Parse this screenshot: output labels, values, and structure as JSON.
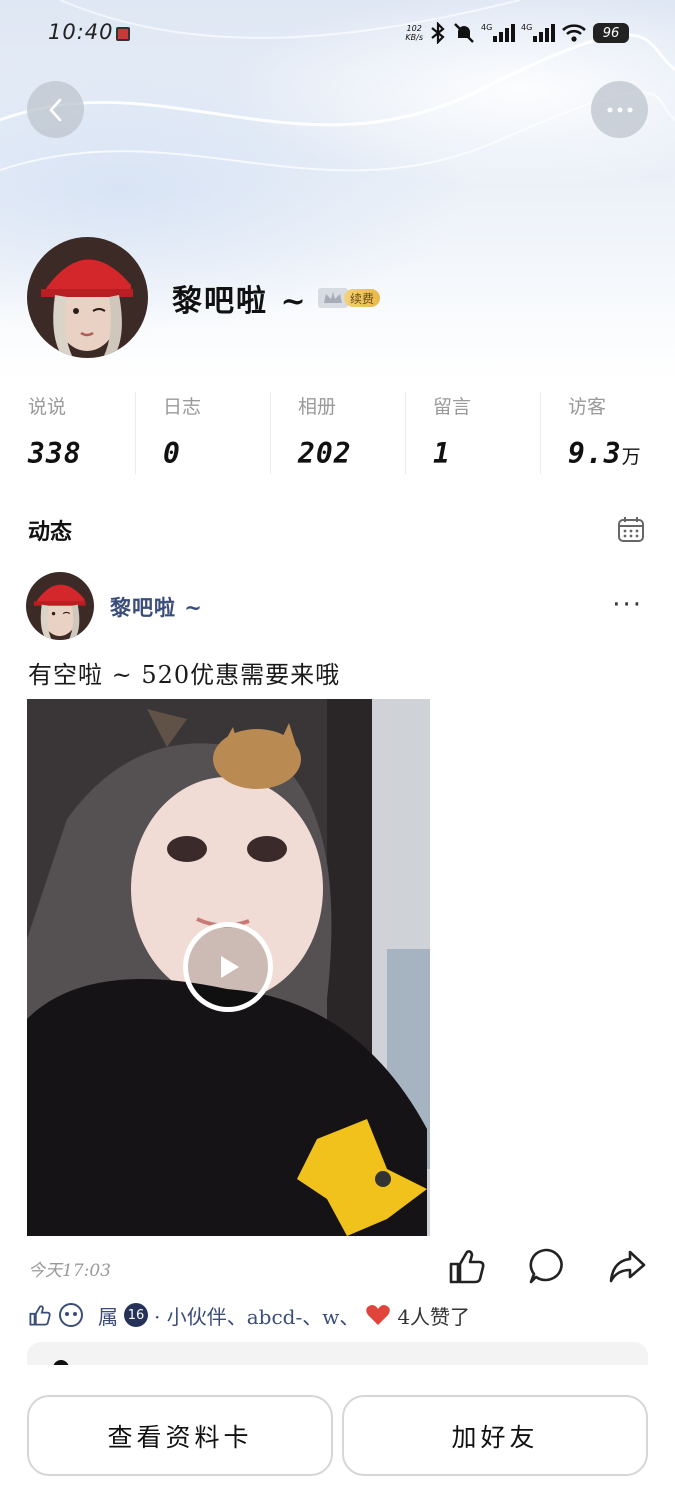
{
  "status_bar": {
    "time": "10:40",
    "net_speed_value": "102",
    "net_speed_unit": "KB/s",
    "battery": "96"
  },
  "profile": {
    "name": "黎吧啦 ~",
    "vip_renew_label": "续费"
  },
  "stats": [
    {
      "label": "说说",
      "value": "338",
      "unit": ""
    },
    {
      "label": "日志",
      "value": "0",
      "unit": ""
    },
    {
      "label": "相册",
      "value": "202",
      "unit": ""
    },
    {
      "label": "留言",
      "value": "1",
      "unit": ""
    },
    {
      "label": "访客",
      "value": "9.3",
      "unit": "万"
    }
  ],
  "feed": {
    "title": "动态"
  },
  "post": {
    "author": "黎吧啦 ~",
    "more": "···",
    "text": "有空啦 ~ 520优惠需要来哦",
    "time": "今天17:03",
    "likes": {
      "partial_name": "属",
      "count_badge": "16",
      "names": "· 小伙伴、abcd-、w、",
      "summary": "4人赞了"
    }
  },
  "bottom": {
    "view_card_label": "查看资料卡",
    "add_friend_label": "加好友"
  },
  "colors": {
    "accent_name": "#3a4d7a",
    "vip_gold": "#e9b84a",
    "heart": "#e0443b"
  }
}
